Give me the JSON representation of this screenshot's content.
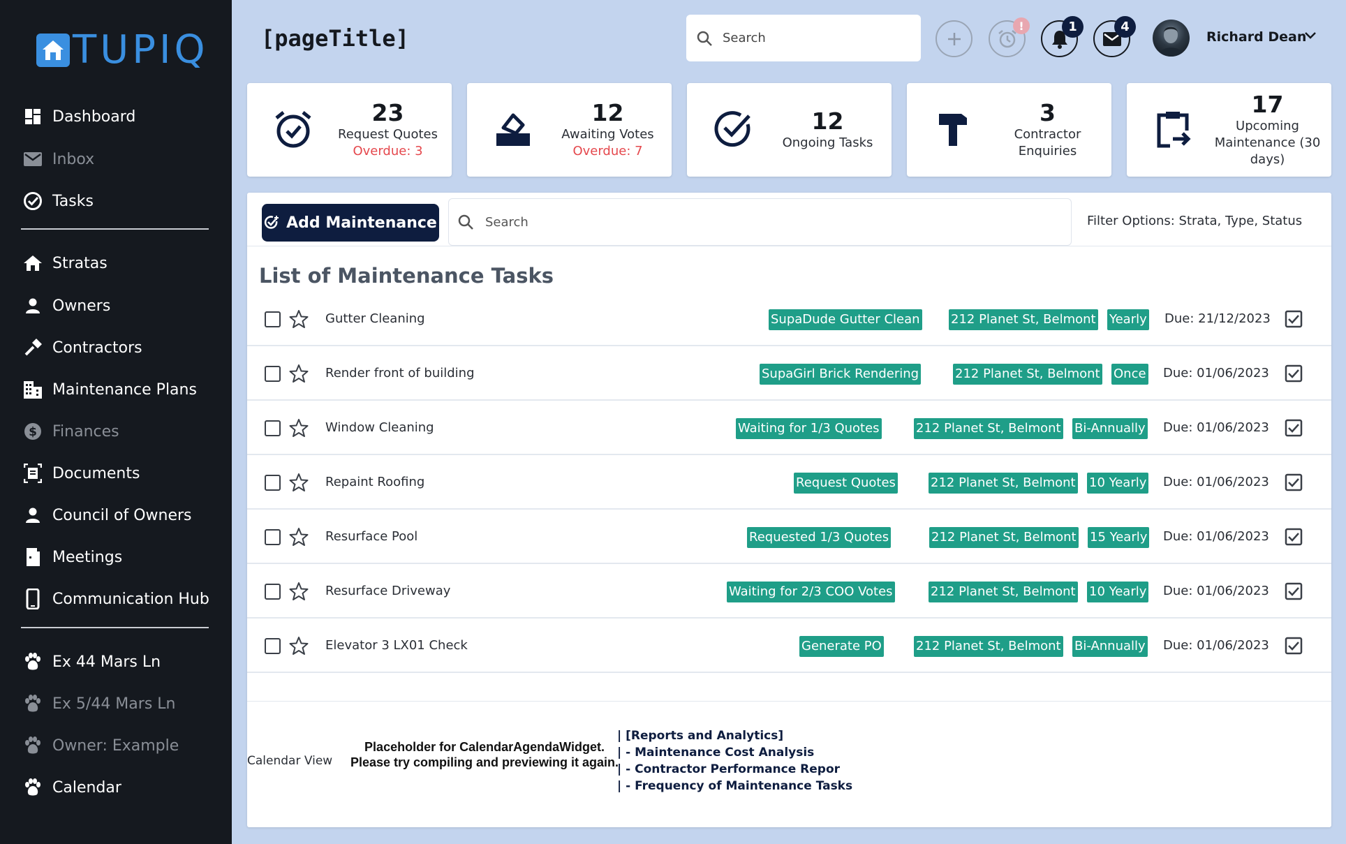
{
  "app": {
    "logo_text": "TUPIQ",
    "page_title": "[pageTitle]"
  },
  "sidebar": {
    "items": [
      {
        "label": "Dashboard",
        "icon": "dashboard-icon",
        "dim": false
      },
      {
        "label": "Inbox",
        "icon": "mail-icon",
        "dim": true
      },
      {
        "label": "Tasks",
        "icon": "check-circle-icon",
        "dim": false
      },
      {
        "label": "Stratas",
        "icon": "home-icon",
        "dim": false
      },
      {
        "label": "Owners",
        "icon": "person-icon",
        "dim": false
      },
      {
        "label": "Contractors",
        "icon": "hammer-icon",
        "dim": false
      },
      {
        "label": "Maintenance Plans",
        "icon": "building-icon",
        "dim": false
      },
      {
        "label": "Finances",
        "icon": "dollar-icon",
        "dim": true
      },
      {
        "label": "Documents",
        "icon": "document-icon",
        "dim": false
      },
      {
        "label": "Council of Owners",
        "icon": "person-icon",
        "dim": false
      },
      {
        "label": "Meetings",
        "icon": "door-icon",
        "dim": false
      },
      {
        "label": "Communication Hub",
        "icon": "phone-icon",
        "dim": false
      },
      {
        "label": "Ex 44 Mars Ln",
        "icon": "paw-icon",
        "dim": false
      },
      {
        "label": "Ex 5/44 Mars Ln",
        "icon": "paw-icon",
        "dim": true
      },
      {
        "label": "Owner: Example",
        "icon": "paw-icon",
        "dim": true
      },
      {
        "label": "Calendar",
        "icon": "paw-icon",
        "dim": false
      }
    ]
  },
  "header": {
    "search_placeholder": "Search",
    "notifications_count": "1",
    "messages_count": "4",
    "alarm_alert": "!",
    "user_name": "Richard Dean"
  },
  "stats": [
    {
      "number": "23",
      "label": "Request Quotes",
      "overdue": "Overdue: 3",
      "icon": "alarm-clock-icon"
    },
    {
      "number": "12",
      "label": "Awaiting Votes",
      "overdue": "Overdue: 7",
      "icon": "ballot-box-icon"
    },
    {
      "number": "12",
      "label": "Ongoing Tasks",
      "overdue": "",
      "icon": "check-circle-icon"
    },
    {
      "number": "3",
      "label": "Contractor Enquiries",
      "overdue": "",
      "icon": "hammer-icon"
    },
    {
      "number": "17",
      "label": "Upcoming Maintenance (30 days)",
      "overdue": "",
      "icon": "clipboard-arrow-icon"
    }
  ],
  "toolbar": {
    "add_label": "Add Maintenance",
    "search_placeholder": "Search",
    "filter_text": "Filter Options: Strata, Type, Status"
  },
  "list": {
    "title": "List of Maintenance Tasks",
    "tag_color": "#1f9e88",
    "rows": [
      {
        "name": "Gutter Cleaning",
        "status": "SupaDude Gutter Clean",
        "address": "212 Planet St, Belmont",
        "frequency": "Yearly",
        "due": "Due: 21/12/2023"
      },
      {
        "name": "Render front of building",
        "status": "SupaGirl Brick Rendering",
        "address": "212 Planet St, Belmont",
        "frequency": "Once",
        "due": "Due: 01/06/2023"
      },
      {
        "name": "Window Cleaning",
        "status": "Waiting for 1/3 Quotes",
        "address": "212 Planet St, Belmont",
        "frequency": "Bi-Annually",
        "due": "Due: 01/06/2023"
      },
      {
        "name": "Repaint Roofing",
        "status": "Request Quotes",
        "address": "212 Planet St, Belmont",
        "frequency": "10 Yearly",
        "due": "Due: 01/06/2023"
      },
      {
        "name": "Resurface Pool",
        "status": "Requested  1/3  Quotes",
        "address": "212 Planet St, Belmont",
        "frequency": "15 Yearly",
        "due": "Due: 01/06/2023"
      },
      {
        "name": "Resurface Driveway",
        "status": "Waiting for 2/3 COO Votes",
        "address": "212 Planet St, Belmont",
        "frequency": "10 Yearly",
        "due": "Due: 01/06/2023"
      },
      {
        "name": "Elevator 3 LX01 Check",
        "status": "Generate PO",
        "address": "212 Planet St, Belmont",
        "frequency": "Bi-Annually",
        "due": "Due: 01/06/2023"
      }
    ]
  },
  "bottom": {
    "calendar_label": "Calendar View",
    "placeholder_text": "Placeholder for CalendarAgendaWidget. Please try compiling and previewing it again.",
    "reports": [
      "| [Reports and Analytics]",
      "| - Maintenance Cost Analysis",
      "| - Contractor Performance Repor",
      "| - Frequency of Maintenance Tasks"
    ]
  }
}
